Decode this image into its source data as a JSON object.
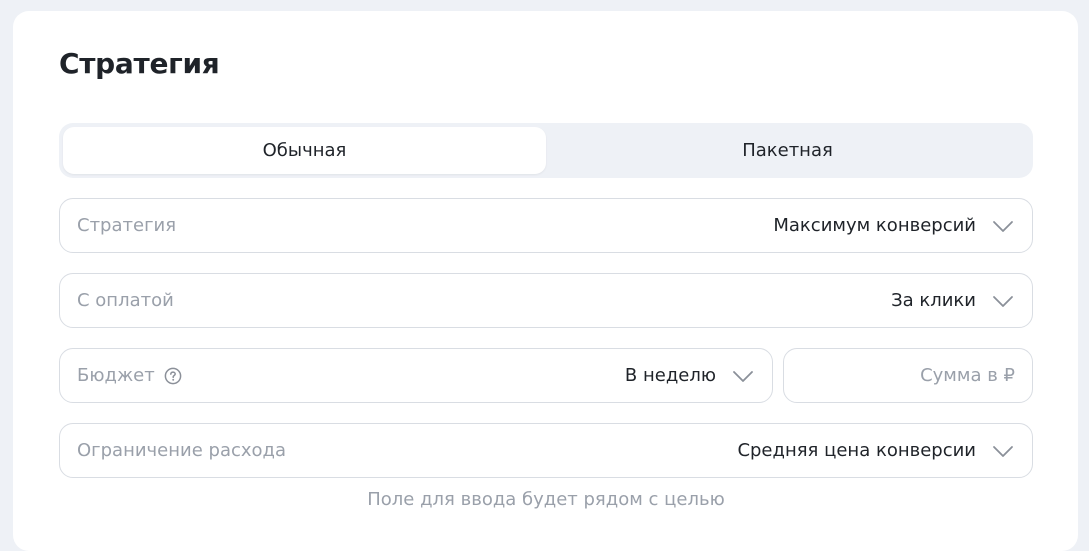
{
  "strategy_section": {
    "title": "Стратегия",
    "tabs": [
      {
        "label": "Обычная",
        "active": true
      },
      {
        "label": "Пакетная",
        "active": false
      }
    ],
    "fields": {
      "strategy": {
        "label": "Стратегия",
        "value": "Максимум конверсий"
      },
      "payment": {
        "label": "С оплатой",
        "value": "За клики"
      },
      "budget": {
        "label": "Бюджет",
        "value": "В неделю",
        "help_icon": "question-circle-icon"
      },
      "amount": {
        "value": "",
        "placeholder": "Сумма в ₽"
      },
      "spend_limit": {
        "label": "Ограничение расхода",
        "value": "Средняя цена конверсии"
      }
    },
    "hint": "Поле для ввода будет рядом с целью"
  },
  "colors": {
    "page_background": "#eef1f6",
    "card_background": "#ffffff",
    "text_primary": "#1f2329",
    "text_secondary": "#9aa0aa",
    "field_border": "#d9dde3"
  }
}
